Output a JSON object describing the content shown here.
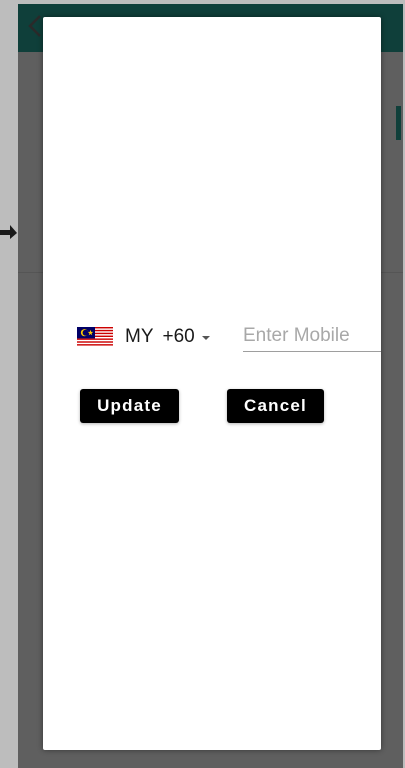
{
  "dialog": {
    "country": {
      "flag_icon": "malaysia-flag-icon",
      "code": "MY",
      "dial_code": "+60"
    },
    "mobile_input": {
      "value": "",
      "placeholder": "Enter Mobile"
    },
    "buttons": {
      "update_label": "Update",
      "cancel_label": "Cancel"
    }
  },
  "colors": {
    "appbar": "#0f3f3a",
    "button_bg": "#000000",
    "button_text": "#ffffff",
    "placeholder": "#a8a8a8"
  }
}
